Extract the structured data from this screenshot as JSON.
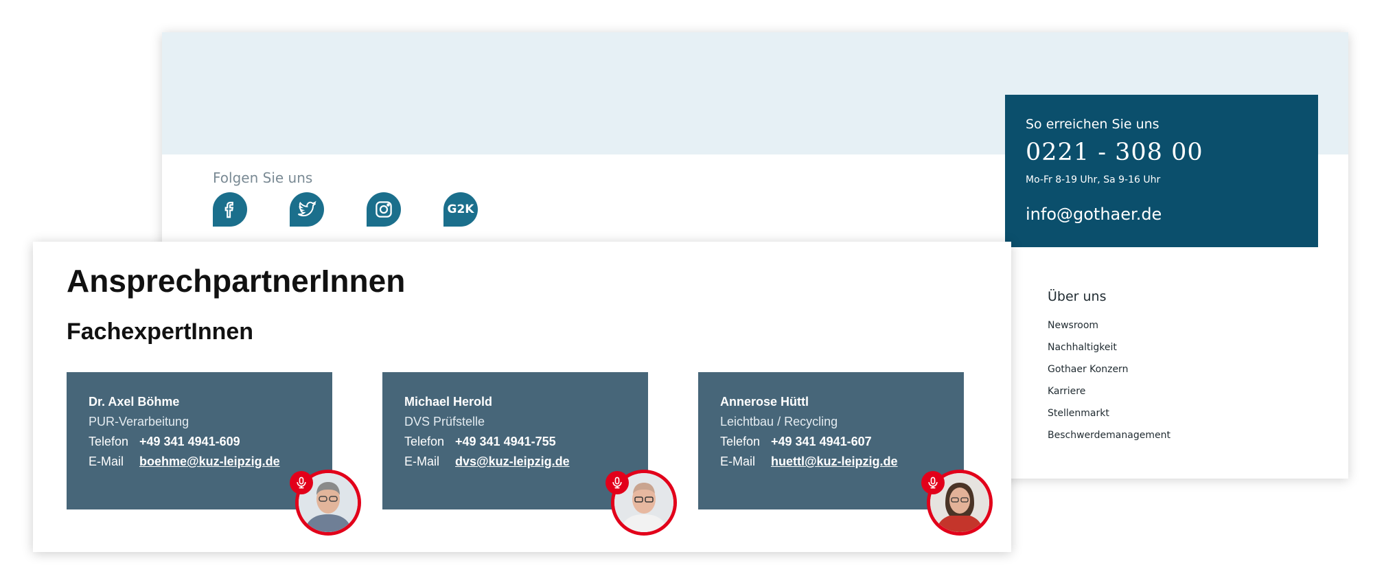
{
  "footer": {
    "follow_label": "Folgen Sie uns",
    "social": [
      {
        "icon": "facebook-icon"
      },
      {
        "icon": "twitter-icon"
      },
      {
        "icon": "instagram-icon"
      },
      {
        "icon": "g2k-icon",
        "label": "G2K"
      }
    ],
    "contact": {
      "heading": "So erreichen Sie uns",
      "phone": "0221 - 308 00",
      "hours": "Mo-Fr 8-19 Uhr, Sa 9-16 Uhr",
      "email": "info@gothaer.de"
    },
    "nav": {
      "title": "Über uns",
      "items": [
        "Newsroom",
        "Nachhaltigkeit",
        "Gothaer Konzern",
        "Karriere",
        "Stellenmarkt",
        "Beschwerdemanagement"
      ]
    }
  },
  "contacts_section": {
    "title": "AnsprechpartnerInnen",
    "subtitle": "FachexpertInnen",
    "phone_label": "Telefon",
    "email_label": "E-Mail",
    "cards": [
      {
        "name": "Dr. Axel Böhme",
        "role": "PUR-Verarbeitung",
        "phone": "+49 341 4941-609",
        "email": "boehme@kuz-leipzig.de"
      },
      {
        "name": "Michael Herold",
        "role": "DVS Prüfstelle",
        "phone": "+49 341 4941-755",
        "email": "dvs@kuz-leipzig.de"
      },
      {
        "name": "Annerose Hüttl",
        "role": "Leichtbau / Recycling",
        "phone": "+49 341 4941-607",
        "email": "huettl@kuz-leipzig.de"
      }
    ]
  },
  "colors": {
    "brand_blue": "#0b4f6c",
    "social_blue": "#1b6f8c",
    "card_bg": "#476679",
    "accent_red": "#e2001a",
    "band_bg": "#e6f0f5"
  }
}
